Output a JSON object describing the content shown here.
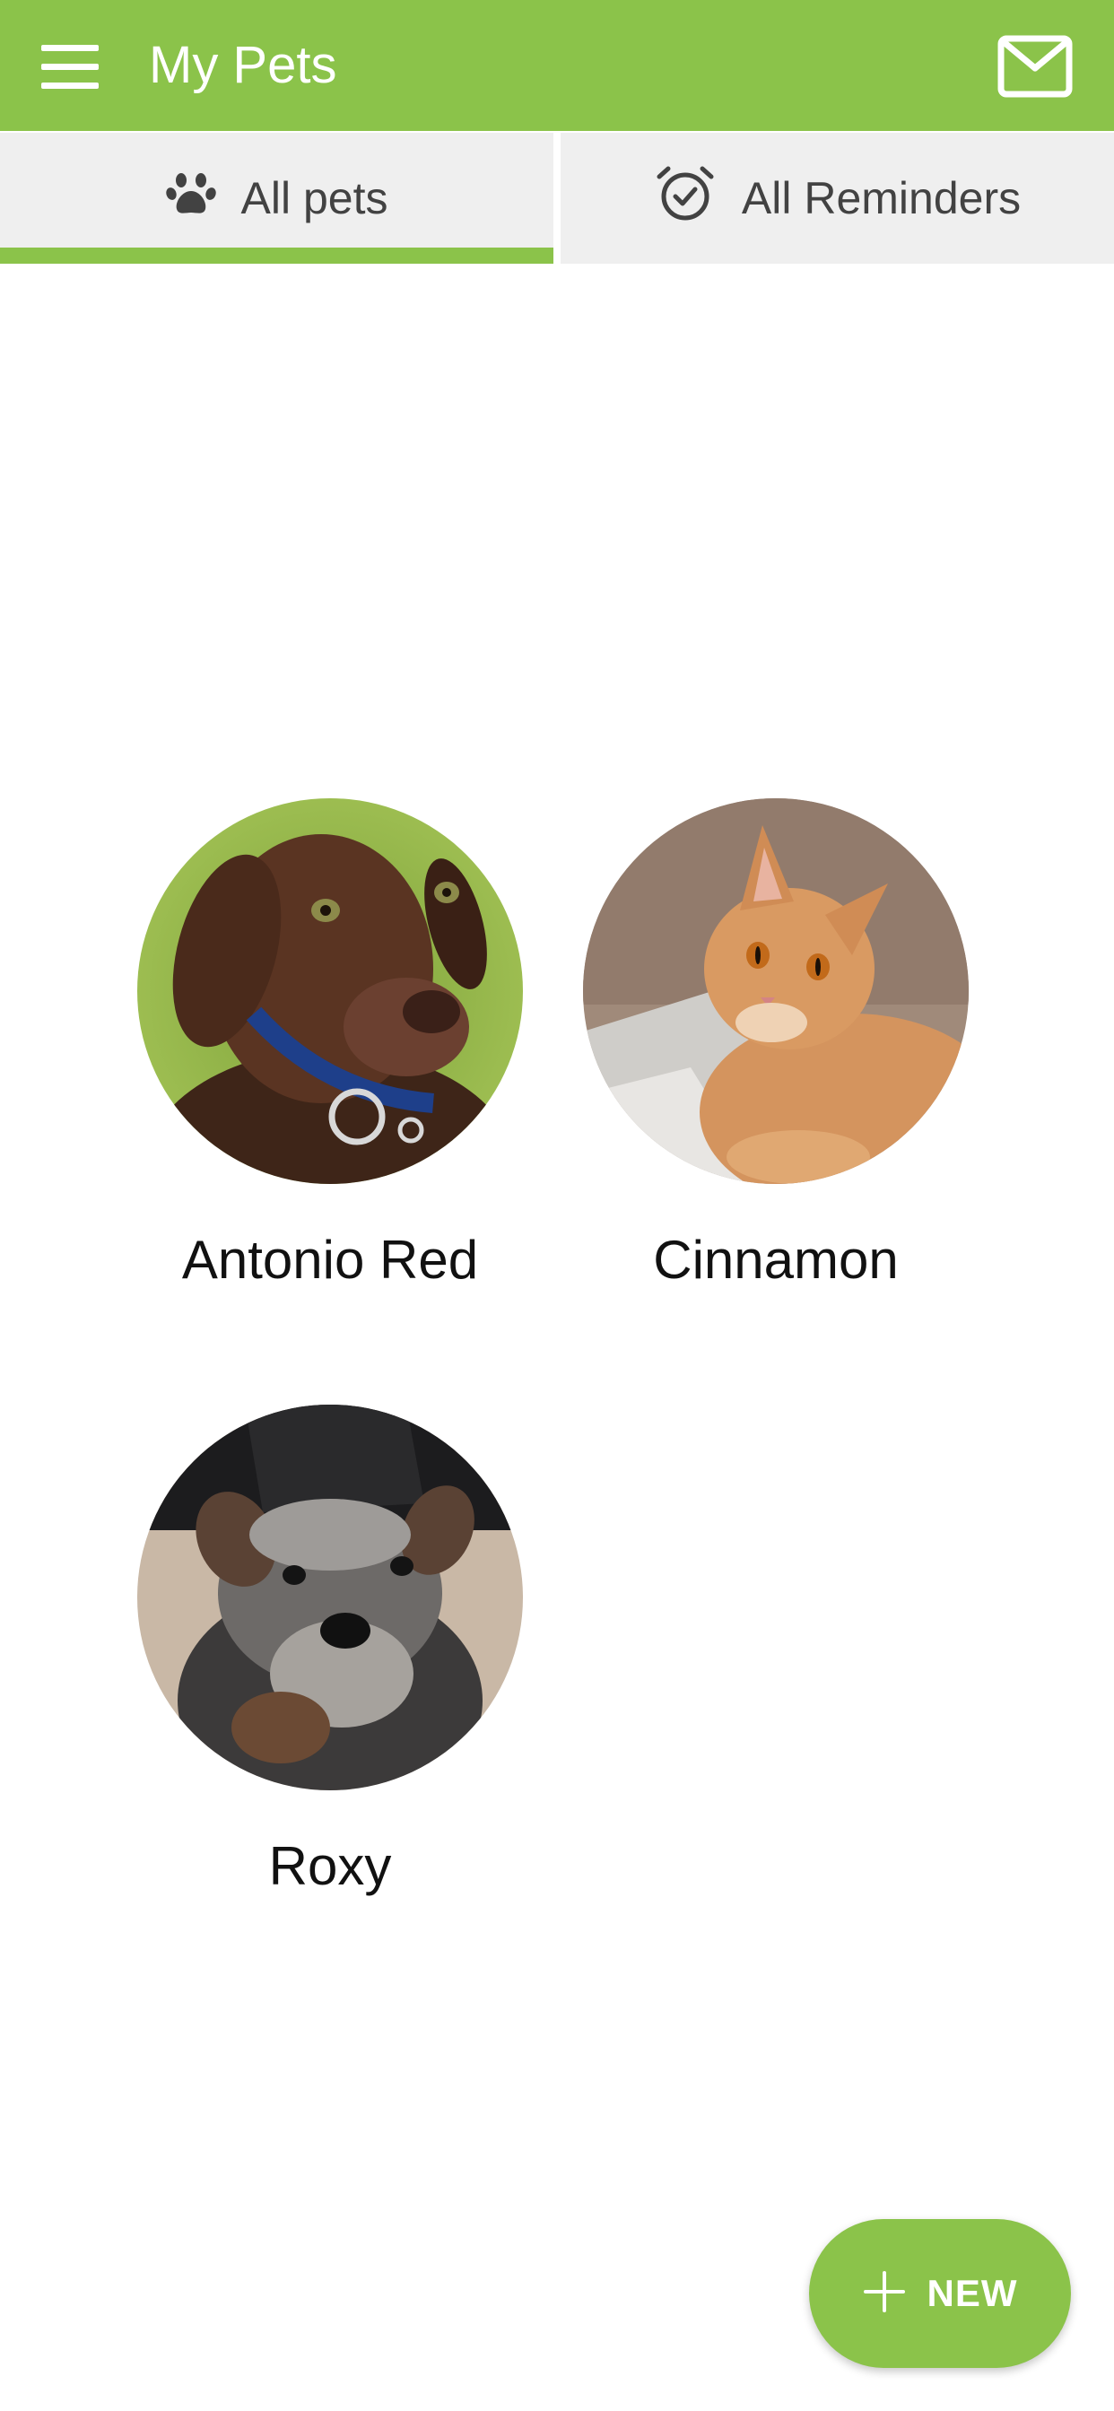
{
  "header": {
    "title": "My Pets",
    "menu_icon": "hamburger-menu-icon",
    "mail_icon": "mail-icon"
  },
  "tabs": [
    {
      "label": "All pets",
      "icon": "paw-icon",
      "selected": true
    },
    {
      "label": "All Reminders",
      "icon": "alarm-check-icon",
      "selected": false
    }
  ],
  "pets": [
    {
      "name": "Antonio Red",
      "photo": "brown labrador puppy with blue collar"
    },
    {
      "name": "Cinnamon",
      "photo": "orange tabby cat lying on couch"
    },
    {
      "name": "Roxy",
      "photo": "grey schnauzer puppy on carpet"
    }
  ],
  "fab": {
    "label": "NEW",
    "icon": "plus-icon"
  },
  "colors": {
    "primary": "#8bc34a",
    "tab_background": "#efefef",
    "text_dark": "#111111"
  }
}
